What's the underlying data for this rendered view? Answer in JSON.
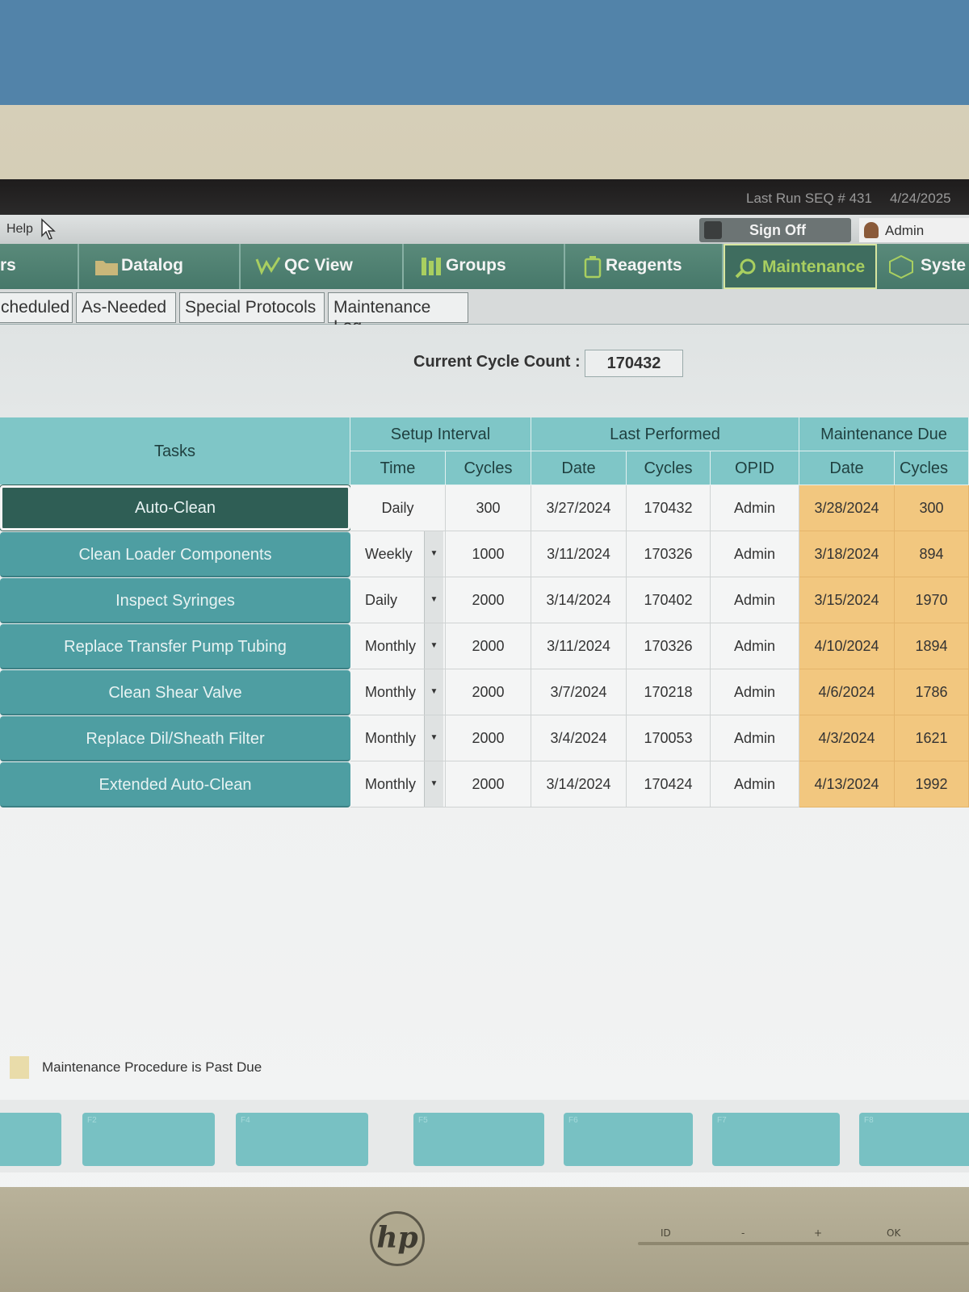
{
  "titlebar": {
    "last_run": "Last Run SEQ # 431",
    "date": "4/24/2025"
  },
  "menubar": {
    "help": "Help",
    "sign_off": "Sign Off",
    "user": "Admin"
  },
  "tabs": [
    {
      "label": "rs",
      "icon": "tab-icon"
    },
    {
      "label": "Datalog",
      "icon": "folder-icon"
    },
    {
      "label": "QC View",
      "icon": "qc-chart-icon"
    },
    {
      "label": "Groups",
      "icon": "groups-icon"
    },
    {
      "label": "Reagents",
      "icon": "reagent-bottle-icon"
    },
    {
      "label": "Maintenance",
      "icon": "maintenance-icon"
    },
    {
      "label": "Syste",
      "icon": "system-cube-icon"
    }
  ],
  "subtabs": [
    "cheduled",
    "As-Needed",
    "Special Protocols",
    "Maintenance Log"
  ],
  "cycle": {
    "label": "Current Cycle Count :",
    "value": "170432"
  },
  "headers": {
    "tasks": "Tasks",
    "setup_interval": "Setup Interval",
    "last_performed": "Last Performed",
    "maintenance_due": "Maintenance Due",
    "time": "Time",
    "cycles": "Cycles",
    "date": "Date",
    "lp_cycles": "Cycles",
    "opid": "OPID",
    "due_date": "Date",
    "cycles_left": "Cycles Le"
  },
  "rows": [
    {
      "task": "Auto-Clean",
      "time": "Daily",
      "cycles": "300",
      "lp_date": "3/27/2024",
      "lp_cycles": "170432",
      "opid": "Admin",
      "due_date": "3/28/2024",
      "cycles_left": "300"
    },
    {
      "task": "Clean Loader Components",
      "time": "Weekly",
      "cycles": "1000",
      "lp_date": "3/11/2024",
      "lp_cycles": "170326",
      "opid": "Admin",
      "due_date": "3/18/2024",
      "cycles_left": "894"
    },
    {
      "task": "Inspect Syringes",
      "time": "Daily",
      "cycles": "2000",
      "lp_date": "3/14/2024",
      "lp_cycles": "170402",
      "opid": "Admin",
      "due_date": "3/15/2024",
      "cycles_left": "1970"
    },
    {
      "task": "Replace Transfer Pump Tubing",
      "time": "Monthly",
      "cycles": "2000",
      "lp_date": "3/11/2024",
      "lp_cycles": "170326",
      "opid": "Admin",
      "due_date": "4/10/2024",
      "cycles_left": "1894"
    },
    {
      "task": "Clean Shear Valve",
      "time": "Monthly",
      "cycles": "2000",
      "lp_date": "3/7/2024",
      "lp_cycles": "170218",
      "opid": "Admin",
      "due_date": "4/6/2024",
      "cycles_left": "1786"
    },
    {
      "task": "Replace Dil/Sheath Filter",
      "time": "Monthly",
      "cycles": "2000",
      "lp_date": "3/4/2024",
      "lp_cycles": "170053",
      "opid": "Admin",
      "due_date": "4/3/2024",
      "cycles_left": "1621"
    },
    {
      "task": "Extended Auto-Clean",
      "time": "Monthly",
      "cycles": "2000",
      "lp_date": "3/14/2024",
      "lp_cycles": "170424",
      "opid": "Admin",
      "due_date": "4/13/2024",
      "cycles_left": "1992"
    }
  ],
  "legend": "Maintenance Procedure is Past Due",
  "fkeys": [
    "",
    "F2",
    "F4",
    "F5",
    "F6",
    "F7",
    "F8"
  ],
  "monitor": {
    "brand": "hp",
    "buttons": [
      "ID",
      "-",
      "+",
      "OK"
    ]
  },
  "colors": {
    "due": "#f2c77f",
    "task_button": "#4e9ea2",
    "header": "#7fc6c7",
    "tabbar": "#46786a"
  }
}
